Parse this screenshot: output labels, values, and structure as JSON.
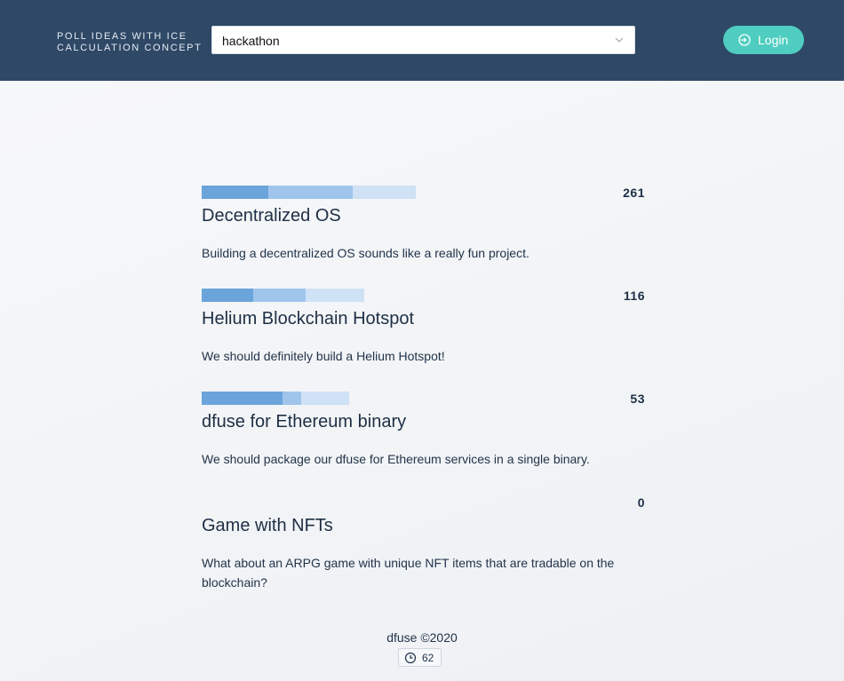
{
  "header": {
    "brand_line1": "POLL IDEAS WITH ICE",
    "brand_line2": "CALCULATION CONCEPT",
    "select_value": "hackathon",
    "select_icon": "chevron-down-icon",
    "login_label": "Login",
    "login_icon": "login-icon",
    "accent_color": "#4ecdc0",
    "header_color": "#2e4866"
  },
  "ideas": [
    {
      "title": "Decentralized OS",
      "description": "Building a decentralized OS sounds like a really fun project.",
      "votes": "261"
    },
    {
      "title": "Helium Blockchain Hotspot",
      "description": "We should definitely build a Helium Hotspot!",
      "votes": "116"
    },
    {
      "title": "dfuse for Ethereum binary",
      "description": "We should package our dfuse for Ethereum services in a single binary.",
      "votes": "53"
    },
    {
      "title": "Game with NFTs",
      "description": "What about an ARPG game with unique NFT items that are tradable on the blockchain?",
      "votes": "0"
    }
  ],
  "footer": {
    "copyright": "dfuse ©2020",
    "timing_icon": "clock-icon",
    "timing_value": "62"
  }
}
